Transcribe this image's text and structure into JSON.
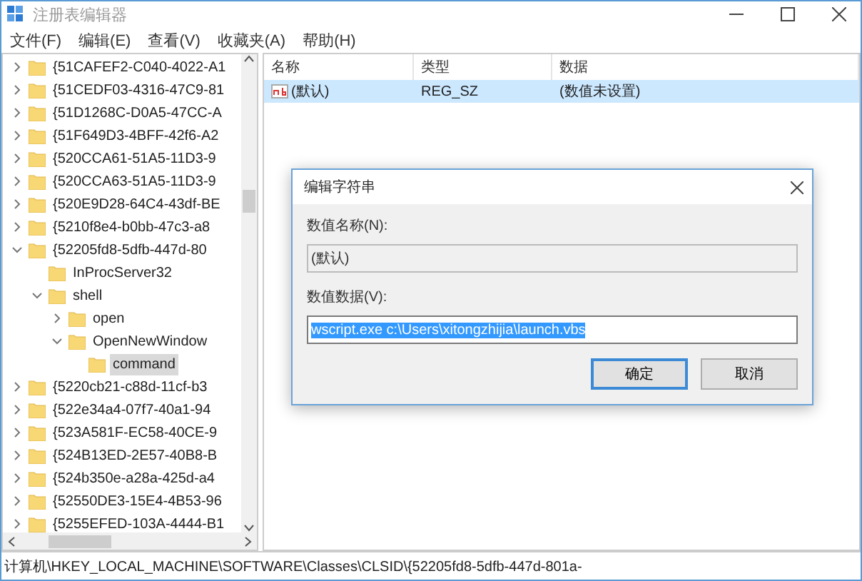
{
  "window": {
    "title": "注册表编辑器"
  },
  "menu": [
    "文件(F)",
    "编辑(E)",
    "查看(V)",
    "收藏夹(A)",
    "帮助(H)"
  ],
  "tree": [
    {
      "label": "{51CAFEF2-C040-4022-A1",
      "expanded": false,
      "selected": false
    },
    {
      "label": "{51CEDF03-4316-47C9-81",
      "expanded": false,
      "selected": false
    },
    {
      "label": "{51D1268C-D0A5-47CC-A",
      "expanded": false,
      "selected": false
    },
    {
      "label": "{51F649D3-4BFF-42f6-A2",
      "expanded": false,
      "selected": false
    },
    {
      "label": "{520CCA61-51A5-11D3-9",
      "expanded": false,
      "selected": false
    },
    {
      "label": "{520CCA63-51A5-11D3-9",
      "expanded": false,
      "selected": false
    },
    {
      "label": "{520E9D28-64C4-43df-BE",
      "expanded": false,
      "selected": false
    },
    {
      "label": "{5210f8e4-b0bb-47c3-a8",
      "expanded": false,
      "selected": false
    },
    {
      "label": "{52205fd8-5dfb-447d-80",
      "expanded": true,
      "selected": false,
      "children": [
        {
          "label": "InProcServer32",
          "selected": false
        },
        {
          "label": "shell",
          "expanded": true,
          "selected": false,
          "children": [
            {
              "label": "open",
              "expanded": false,
              "selected": false
            },
            {
              "label": "OpenNewWindow",
              "expanded": true,
              "selected": false,
              "children": [
                {
                  "label": "command",
                  "selected": true
                }
              ]
            }
          ]
        }
      ]
    },
    {
      "label": "{5220cb21-c88d-11cf-b3",
      "expanded": false,
      "selected": false
    },
    {
      "label": "{522e34a4-07f7-40a1-94",
      "expanded": false,
      "selected": false
    },
    {
      "label": "{523A581F-EC58-40CE-9",
      "expanded": false,
      "selected": false
    },
    {
      "label": "{524B13ED-2E57-40B8-B",
      "expanded": false,
      "selected": false
    },
    {
      "label": "{524b350e-a28a-425d-a4",
      "expanded": false,
      "selected": false
    },
    {
      "label": "{52550DE3-15E4-4B53-96",
      "expanded": false,
      "selected": false
    },
    {
      "label": "{5255EFED-103A-4444-B1",
      "expanded": false,
      "selected": false
    }
  ],
  "table": {
    "columns": [
      "名称",
      "类型",
      "数据"
    ],
    "rows": [
      {
        "name": "(默认)",
        "type": "REG_SZ",
        "data": "(数值未设置)",
        "selected": true
      }
    ]
  },
  "dialog": {
    "title": "编辑字符串",
    "name_label": "数值名称(N):",
    "name_value": "(默认)",
    "data_label": "数值数据(V):",
    "data_value": "wscript.exe c:\\Users\\xitongzhijia\\launch.vbs",
    "buttons": [
      {
        "label": "确定",
        "focused": true
      },
      {
        "label": "取消",
        "focused": false
      }
    ]
  },
  "status_bar": "计算机\\HKEY_LOCAL_MACHINE\\SOFTWARE\\Classes\\CLSID\\{52205fd8-5dfb-447d-801a-"
}
